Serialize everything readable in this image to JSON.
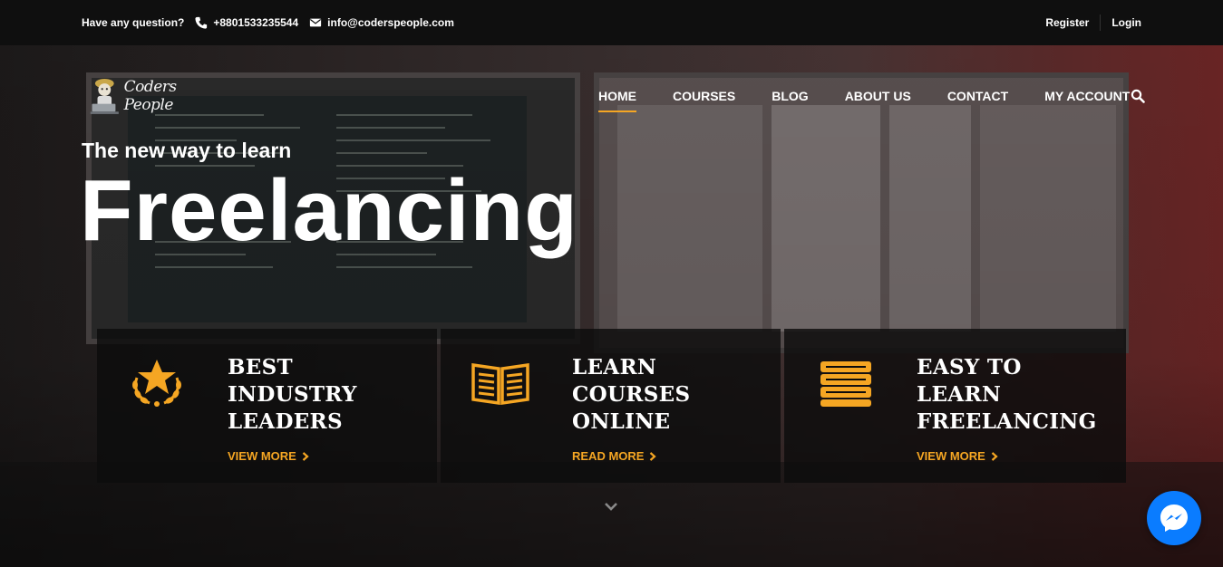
{
  "topbar": {
    "question": "Have any question?",
    "phone": "+8801533235544",
    "email": "info@coderspeople.com",
    "register": "Register",
    "login": "Login"
  },
  "brand": {
    "name": "Coders People"
  },
  "nav": {
    "items": [
      "HOME",
      "COURSES",
      "BLOG",
      "ABOUT US",
      "CONTACT",
      "MY ACCOUNT"
    ],
    "active": "HOME"
  },
  "hero": {
    "tagline": "The new way to learn",
    "headline": "Freelancing"
  },
  "features": [
    {
      "title_lines": [
        "BEST",
        "INDUSTRY",
        "LEADERS"
      ],
      "link": "VIEW MORE",
      "icon": "star-laurel-icon"
    },
    {
      "title_lines": [
        "LEARN",
        "COURSES",
        "ONLINE"
      ],
      "link": "READ MORE",
      "icon": "open-book-icon"
    },
    {
      "title_lines": [
        "EASY TO",
        "LEARN",
        "FREELANCING"
      ],
      "link": "VIEW MORE",
      "icon": "book-stack-icon"
    }
  ],
  "colors": {
    "accent": "#f5a623",
    "messenger": "#0a7cff",
    "topbar": "#0f0f0f"
  }
}
